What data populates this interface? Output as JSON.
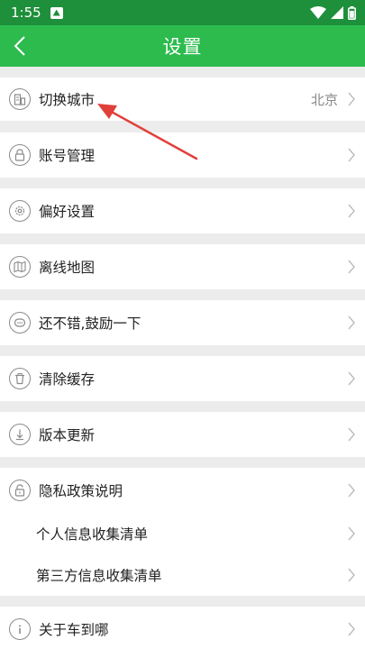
{
  "status_bar": {
    "time": "1:55"
  },
  "header": {
    "title": "设置"
  },
  "items": {
    "switch_city": {
      "label": "切换城市",
      "value": "北京"
    },
    "account": {
      "label": "账号管理"
    },
    "preferences": {
      "label": "偏好设置"
    },
    "offline_map": {
      "label": "离线地图"
    },
    "rate": {
      "label": "还不错,鼓励一下"
    },
    "clear_cache": {
      "label": "清除缓存"
    },
    "version_update": {
      "label": "版本更新"
    },
    "privacy_policy": {
      "label": "隐私政策说明"
    },
    "personal_info_list": {
      "label": "个人信息收集清单"
    },
    "third_party_list": {
      "label": "第三方信息收集清单"
    },
    "about": {
      "label": "关于车到哪"
    }
  },
  "colors": {
    "status_bar": "#1e8f3a",
    "app_bar": "#2dbb4e",
    "annotation": "#e0403a"
  }
}
